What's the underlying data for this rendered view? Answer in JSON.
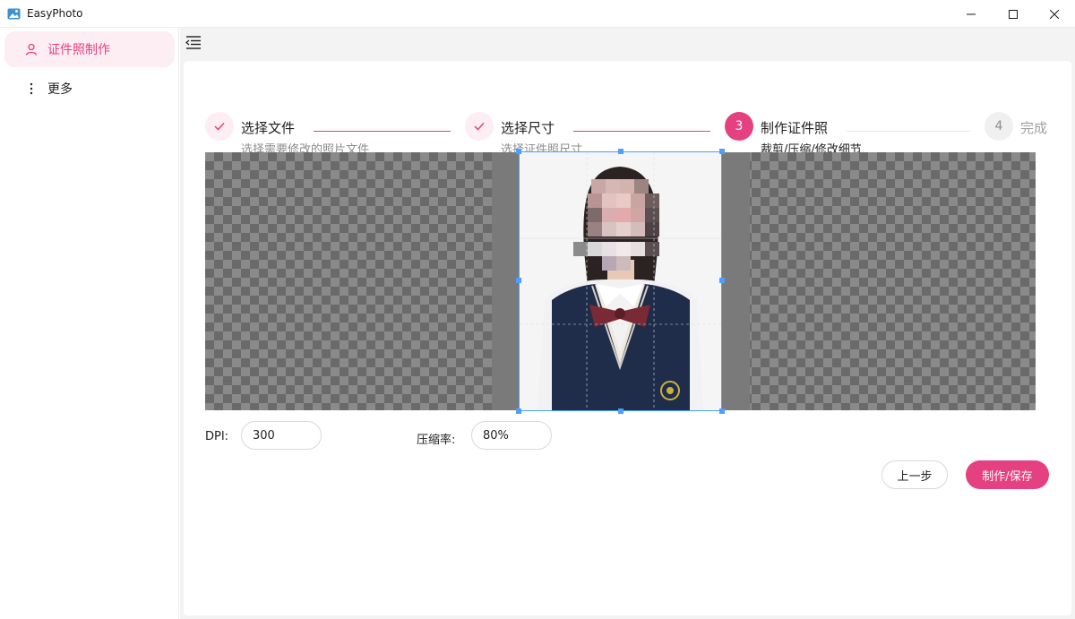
{
  "window": {
    "title": "EasyPhoto"
  },
  "sidebar": {
    "items": [
      {
        "label": "证件照制作",
        "icon": "user-icon",
        "active": true
      },
      {
        "label": "更多",
        "icon": "more-vertical-icon",
        "active": false
      }
    ]
  },
  "steps": [
    {
      "number": "1",
      "title": "选择文件",
      "desc": "选择需要修改的照片文件",
      "status": "done"
    },
    {
      "number": "2",
      "title": "选择尺寸",
      "desc": "选择证件照尺寸",
      "status": "done"
    },
    {
      "number": "3",
      "title": "制作证件照",
      "desc": "裁剪/压缩/修改细节",
      "status": "current"
    },
    {
      "number": "4",
      "title": "完成",
      "desc": "",
      "status": "pending"
    }
  ],
  "form": {
    "dpi_label": "DPI:",
    "dpi_value": "300",
    "compress_label": "压缩率:",
    "compress_value": "80%"
  },
  "actions": {
    "prev_label": "上一步",
    "save_label": "制作/保存"
  },
  "colors": {
    "accent": "#e5407f",
    "accent_light": "#fdeef3",
    "crop_border": "#4a9fff"
  }
}
